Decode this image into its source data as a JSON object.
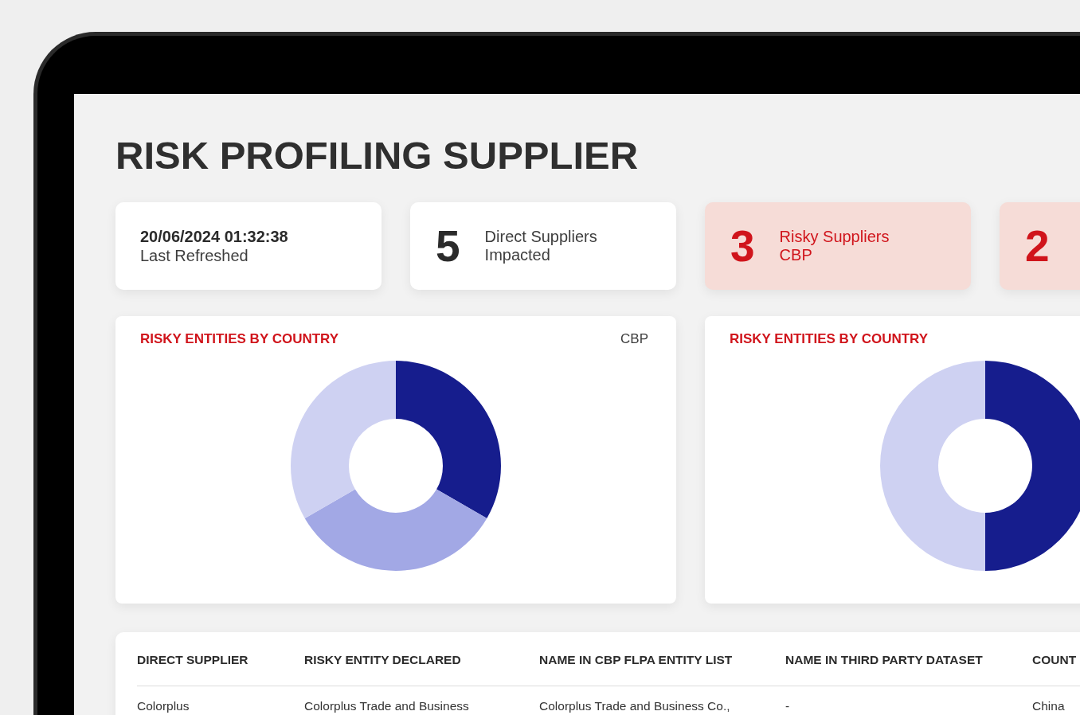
{
  "title": "RISK PROFILING SUPPLIER",
  "cards": [
    {
      "kind": "timestamp",
      "value": "20/06/2024 01:32:38",
      "label_lines": [
        "Last Refreshed"
      ],
      "alert": false
    },
    {
      "kind": "stat",
      "value": "5",
      "label_lines": [
        "Direct Suppliers",
        "Impacted"
      ],
      "alert": false
    },
    {
      "kind": "stat",
      "value": "3",
      "label_lines": [
        "Risky Suppliers",
        "CBP"
      ],
      "alert": true
    },
    {
      "kind": "stat",
      "value": "2",
      "alert": true
    }
  ],
  "charts": [
    {
      "title": "RISKY ENTITIES BY COUNTRY",
      "source": "CBP"
    },
    {
      "title": "RISKY ENTITIES BY COUNTRY"
    }
  ],
  "table": {
    "columns": [
      "DIRECT SUPPLIER",
      "RISKY ENTITY DECLARED",
      "NAME IN CBP FLPA ENTITY LIST",
      "NAME IN THIRD PARTY DATASET",
      "COUNT"
    ],
    "rows": [
      [
        "Colorplus",
        "Colorplus Trade and Business",
        "Colorplus Trade and Business Co.,",
        "-",
        "China"
      ]
    ]
  }
}
